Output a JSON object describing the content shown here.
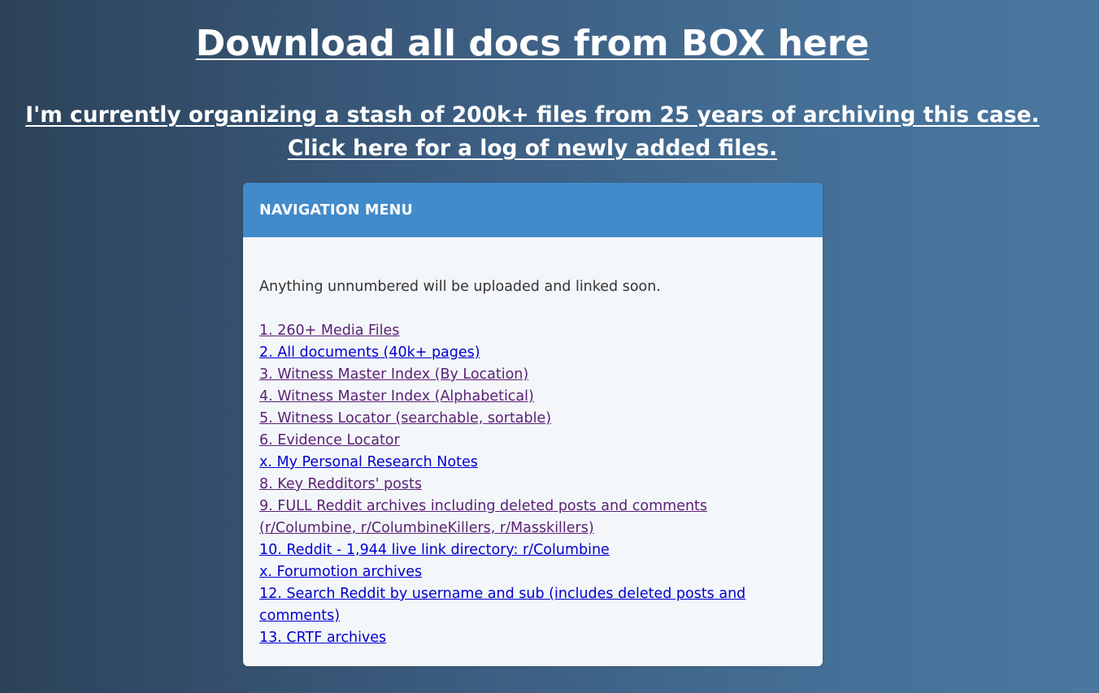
{
  "header": {
    "title": "Download all docs from BOX here",
    "sub_line1": "I'm currently organizing a stash of 200k+ files from 25 years of archiving this case.",
    "sub_line2": "Click here for a log of newly added files."
  },
  "panel": {
    "heading": "NAVIGATION MENU",
    "note": "Anything unnumbered will be uploaded and linked soon.",
    "items": [
      {
        "label": "1. 260+ Media Files",
        "state": "visited"
      },
      {
        "label": "2. All documents (40k+ pages)",
        "state": "unvisited"
      },
      {
        "label": "3. Witness Master Index (By Location)",
        "state": "visited"
      },
      {
        "label": "4. Witness Master Index (Alphabetical)",
        "state": "visited"
      },
      {
        "label": "5. Witness Locator (searchable, sortable)",
        "state": "visited"
      },
      {
        "label": "6. Evidence Locator",
        "state": "visited"
      },
      {
        "label": "x. My Personal Research Notes",
        "state": "unvisited"
      },
      {
        "label": "8. Key Redditors' posts",
        "state": "visited"
      },
      {
        "label": "9. FULL Reddit archives including deleted posts and comments (r/Columbine, r/ColumbineKillers, r/Masskillers)",
        "state": "visited"
      },
      {
        "label": "10. Reddit - 1,944 live link directory: r/Columbine",
        "state": "unvisited"
      },
      {
        "label": "x. Forumotion archives",
        "state": "unvisited"
      },
      {
        "label": "12. Search Reddit by username and sub (includes deleted posts and comments)",
        "state": "unvisited"
      },
      {
        "label": "13. CRTF archives",
        "state": "unvisited"
      }
    ]
  },
  "colors": {
    "visited_link": "#5a2176",
    "unvisited_link": "#0000cc",
    "panel_header": "#428bca"
  }
}
